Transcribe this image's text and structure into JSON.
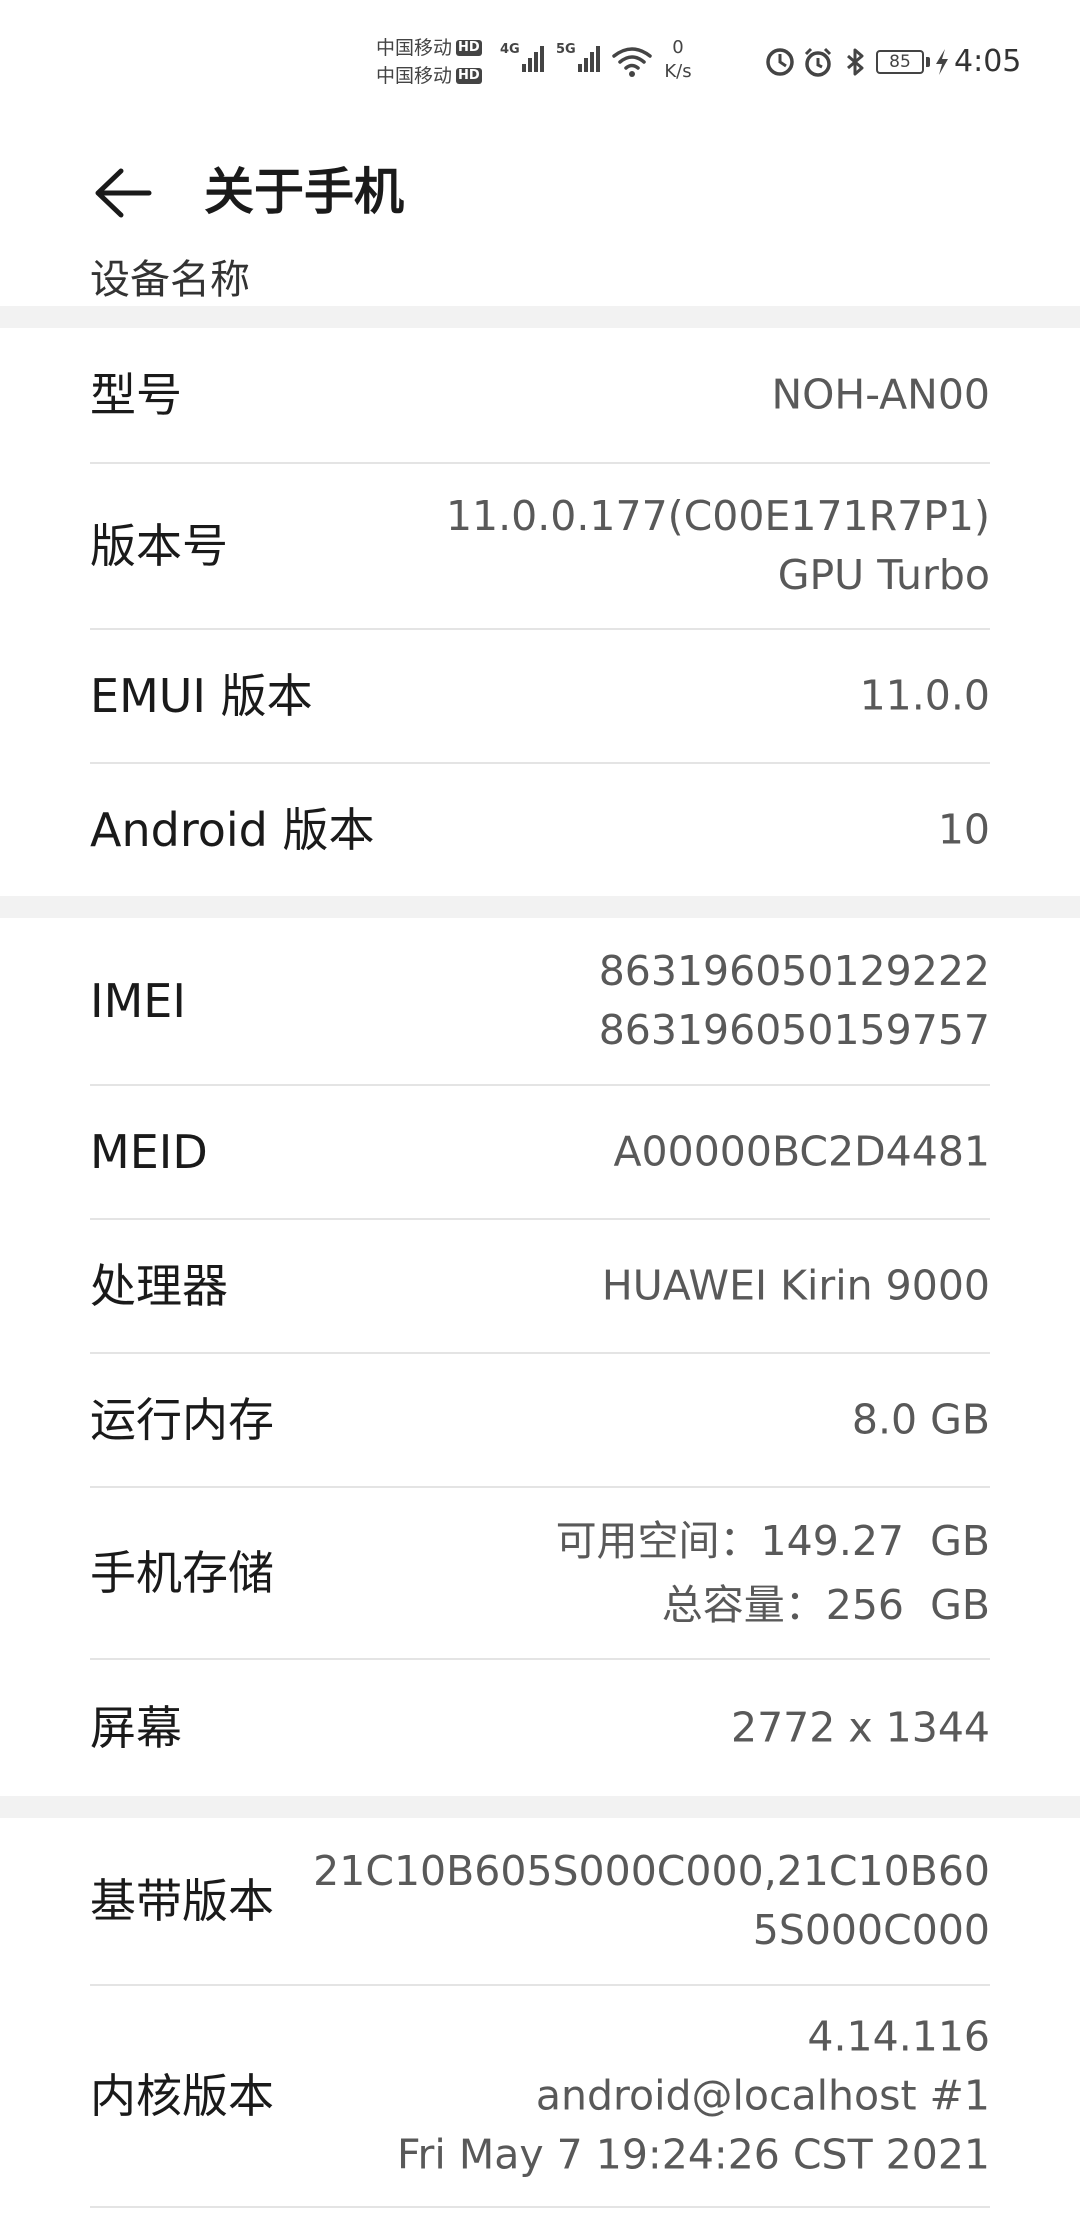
{
  "status_bar": {
    "carrier_1": "中国移动",
    "carrier_2": "中国移动",
    "hd_badge": "HD",
    "network_gen_1": "4G",
    "network_gen_2": "5G",
    "net_speed_value": "0",
    "net_speed_unit": "K/s",
    "battery_level": "85",
    "time": "4:05",
    "icons": [
      "hd-call-icon",
      "signal-icon",
      "wifi-icon",
      "data-saver-icon",
      "alarm-icon",
      "bluetooth-icon",
      "battery-icon",
      "charging-icon"
    ]
  },
  "header": {
    "title": "关于手机",
    "back_icon": "arrow-left-icon",
    "cut_off_text": "设备名称"
  },
  "sections": [
    {
      "rows": [
        {
          "label": "型号",
          "value": [
            "NOH-AN00"
          ]
        },
        {
          "label": "版本号",
          "value": [
            "11.0.0.177(C00E171R7P1)",
            "GPU Turbo"
          ]
        },
        {
          "label": "EMUI 版本",
          "value": [
            "11.0.0"
          ]
        },
        {
          "label": "Android 版本",
          "value": [
            "10"
          ]
        }
      ]
    },
    {
      "rows": [
        {
          "label": "IMEI",
          "value": [
            "863196050129222",
            "863196050159757"
          ]
        },
        {
          "label": "MEID",
          "value": [
            "A00000BC2D4481"
          ]
        },
        {
          "label": "处理器",
          "value": [
            "HUAWEI Kirin 9000"
          ]
        },
        {
          "label": "运行内存",
          "value": [
            "8.0 GB"
          ]
        },
        {
          "label": "手机存储",
          "value": [
            "可用空间：149.27  GB",
            "总容量：256  GB"
          ]
        },
        {
          "label": "屏幕",
          "value": [
            "2772 x 1344"
          ]
        }
      ]
    },
    {
      "rows": [
        {
          "label": "基带版本",
          "value": [
            "21C10B605S000C000,21C10B60",
            "5S000C000"
          ]
        },
        {
          "label": "内核版本",
          "value": [
            "4.14.116",
            "android@localhost #1",
            "Fri May 7 19:24:26 CST 2021"
          ]
        }
      ]
    }
  ]
}
